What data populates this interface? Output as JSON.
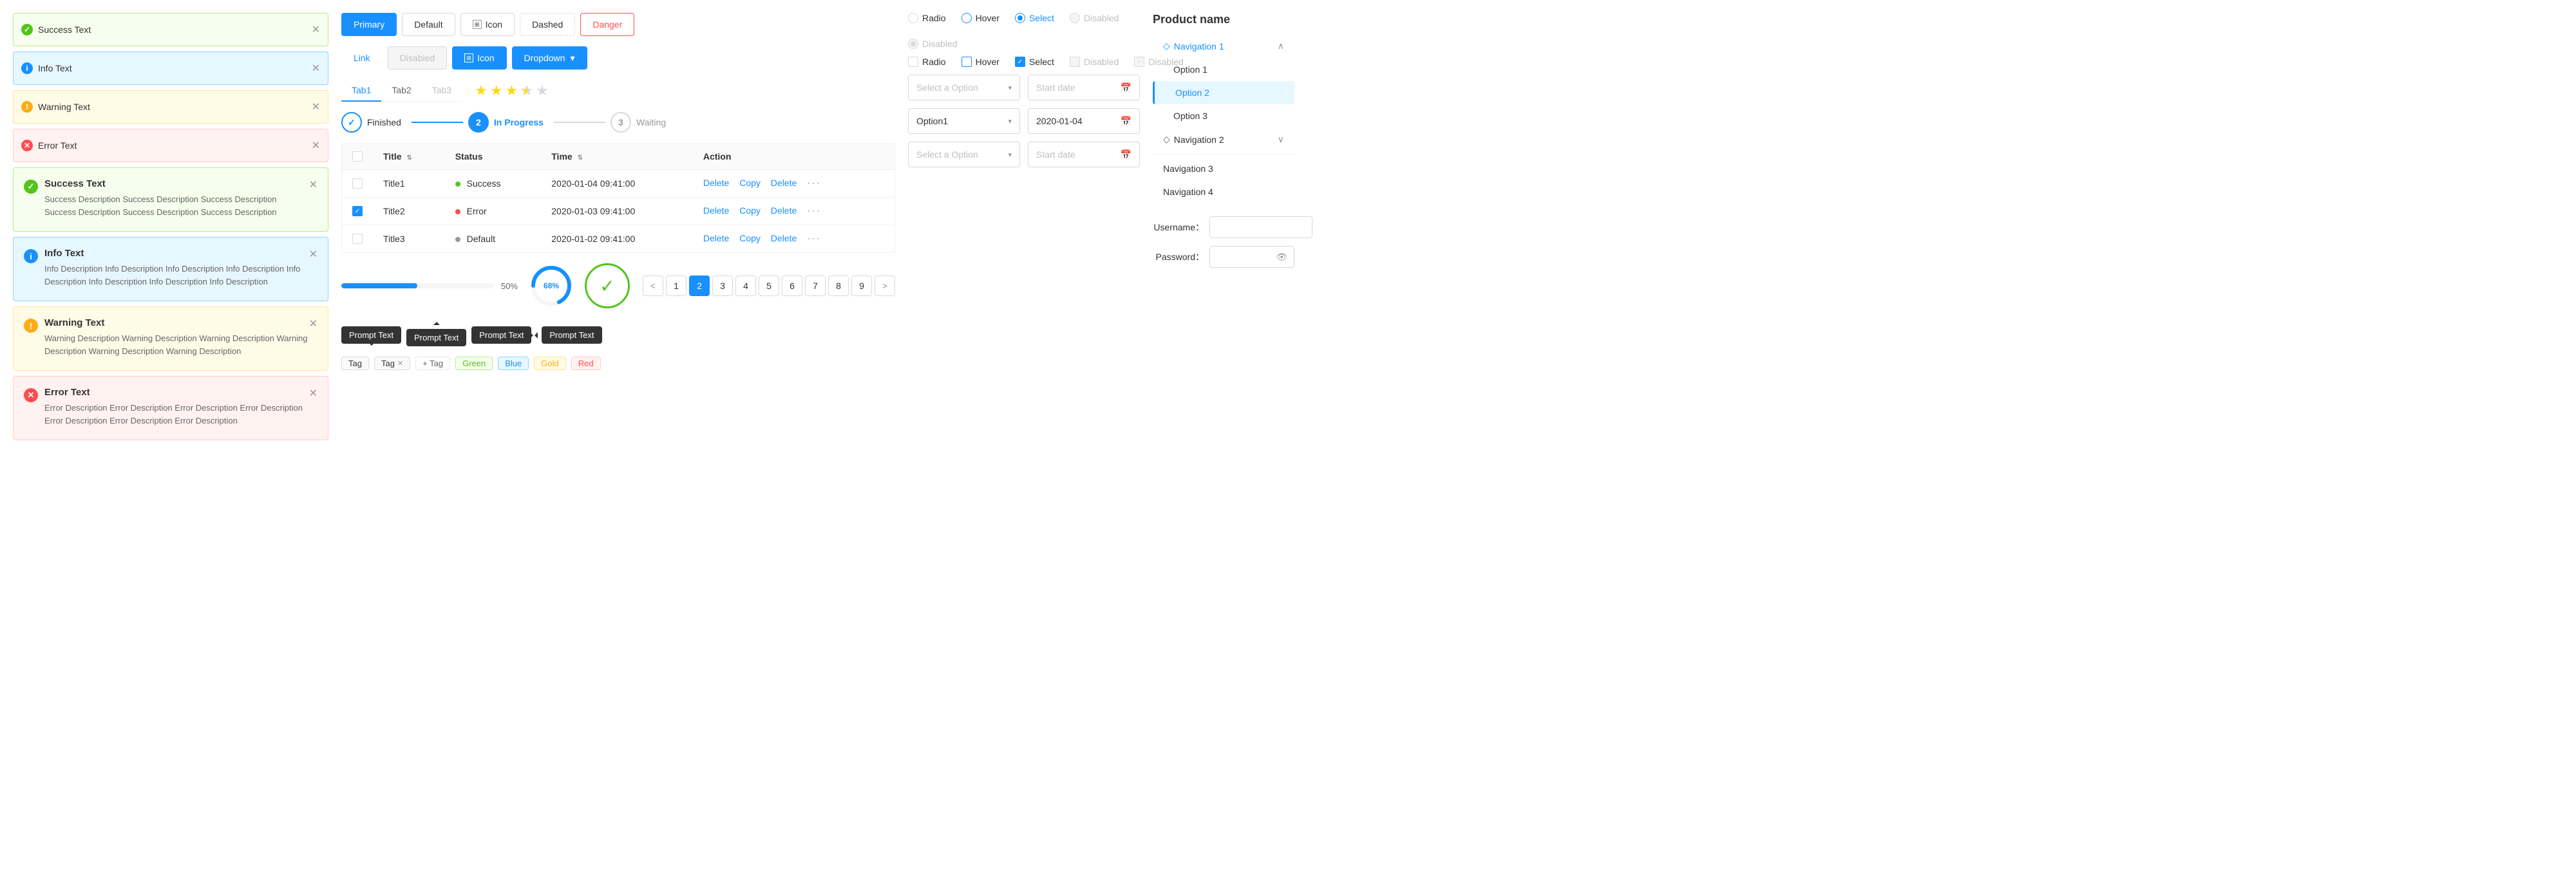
{
  "alerts": {
    "simple": [
      {
        "type": "success",
        "text": "Success Text"
      },
      {
        "type": "info",
        "text": "Info Text"
      },
      {
        "type": "warning",
        "text": "Warning Text"
      },
      {
        "type": "error",
        "text": "Error Text"
      }
    ],
    "detailed": [
      {
        "type": "success",
        "title": "Success Text",
        "desc": "Success Description Success Description Success Description Success Description Success Description Success Description"
      },
      {
        "type": "info",
        "title": "Info Text",
        "desc": "Info Description Info Description Info Description Info Description Info Description Info Description Info Description Info Description"
      },
      {
        "type": "warning",
        "title": "Warning Text",
        "desc": "Warning Description Warning Description Warning Description Warning Description Warning Description Warning Description"
      },
      {
        "type": "error",
        "title": "Error Text",
        "desc": "Error Description Error Description Error Description Error Description Error Description Error Description Error Description"
      }
    ]
  },
  "buttons": {
    "row1": [
      {
        "label": "Primary",
        "type": "primary"
      },
      {
        "label": "Default",
        "type": "default"
      },
      {
        "label": "Icon",
        "type": "icon"
      },
      {
        "label": "Dashed",
        "type": "dashed"
      },
      {
        "label": "Danger",
        "type": "danger"
      }
    ],
    "row2": [
      {
        "label": "Link",
        "type": "link"
      },
      {
        "label": "Disabled",
        "type": "disabled"
      },
      {
        "label": "Icon",
        "type": "icon-blue"
      },
      {
        "label": "Dropdown",
        "type": "dropdown"
      }
    ]
  },
  "radios_row1": [
    {
      "label": "Radio",
      "state": "unchecked"
    },
    {
      "label": "Hover",
      "state": "hover"
    },
    {
      "label": "Select",
      "state": "selected"
    },
    {
      "label": "Disabled",
      "state": "disabled"
    },
    {
      "label": "Disabled",
      "state": "disabled-selected"
    }
  ],
  "radios_row2": [
    {
      "label": "Radio",
      "state": "unchecked"
    },
    {
      "label": "Hover",
      "state": "hover"
    },
    {
      "label": "Select",
      "state": "selected"
    },
    {
      "label": "Disabled",
      "state": "disabled"
    },
    {
      "label": "Disabled",
      "state": "disabled-checked"
    }
  ],
  "tabs": [
    {
      "label": "Tab1",
      "active": true
    },
    {
      "label": "Tab2",
      "active": false
    },
    {
      "label": "Tab3",
      "active": false,
      "disabled": true
    }
  ],
  "stars": {
    "filled": 3,
    "half": true,
    "empty": 1,
    "total": 5
  },
  "steps": [
    {
      "label": "Finished",
      "state": "finished",
      "num": "✓"
    },
    {
      "label": "In Progress",
      "state": "active",
      "num": "2"
    },
    {
      "label": "Waiting",
      "state": "waiting",
      "num": "3"
    }
  ],
  "table": {
    "columns": [
      "",
      "Title",
      "Status",
      "Time",
      "Action"
    ],
    "rows": [
      {
        "checked": false,
        "title": "Title1",
        "status": "Success",
        "statusType": "success",
        "time": "2020-01-04  09:41:00",
        "actions": [
          "Delete",
          "Copy",
          "Delete"
        ]
      },
      {
        "checked": true,
        "title": "Title2",
        "status": "Error",
        "statusType": "error",
        "time": "2020-01-03  09:41:00",
        "actions": [
          "Delete",
          "Copy",
          "Delete"
        ]
      },
      {
        "checked": false,
        "title": "Title3",
        "status": "Default",
        "statusType": "default",
        "time": "2020-01-02  09:41:00",
        "actions": [
          "Delete",
          "Copy",
          "Delete"
        ]
      }
    ]
  },
  "pagination": {
    "prev": "<",
    "next": ">",
    "pages": [
      1,
      2,
      3,
      4,
      5,
      6,
      7,
      8,
      9
    ],
    "active": 2
  },
  "progress": {
    "bar_percent": 50,
    "bar_label": "50%",
    "circle_percent": 68,
    "circle_label": "68%",
    "check_done": true
  },
  "tooltips": [
    {
      "label": "Prompt Text",
      "arrow": "bottom"
    },
    {
      "label": "Prompt Text",
      "arrow": "top"
    },
    {
      "label": "Prompt Text",
      "arrow": "right"
    },
    {
      "label": "Prompt Text",
      "arrow": "left"
    }
  ],
  "tags": {
    "plain": [
      "Tag"
    ],
    "closeable": [
      "Tag"
    ],
    "add_label": "+ Tag",
    "colored": [
      "Green",
      "Blue",
      "Gold",
      "Red"
    ]
  },
  "selects": {
    "placeholder1": "Select a Option",
    "value1": "Option1",
    "placeholder2": "Select a Option",
    "dropdown_icon": "▾"
  },
  "dates": {
    "placeholder": "Start date",
    "value": "2020-01-04",
    "placeholder2": "Start date"
  },
  "navigation": {
    "title": "Product name",
    "items": [
      {
        "label": "Navigation 1",
        "expanded": true,
        "type": "parent"
      },
      {
        "label": "Option 1",
        "type": "sub"
      },
      {
        "label": "Option 2",
        "type": "sub",
        "active": true
      },
      {
        "label": "Option 3",
        "type": "sub"
      },
      {
        "label": "Navigation 2",
        "type": "parent",
        "expanded": false
      },
      {
        "label": "Navigation 3",
        "type": "parent"
      },
      {
        "label": "Navigation 4",
        "type": "parent"
      }
    ]
  },
  "login": {
    "username_label": "Username：",
    "password_label": "Password："
  }
}
